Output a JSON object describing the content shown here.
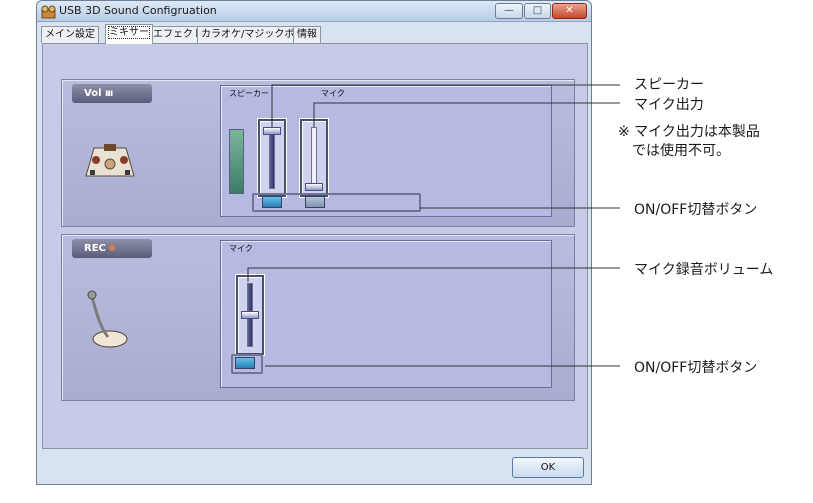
{
  "window": {
    "title": "USB 3D Sound Configruation",
    "minimize_glyph": "—",
    "maximize_glyph": "□",
    "close_glyph": "✕"
  },
  "tabs": [
    {
      "label": "メイン設定",
      "active": false
    },
    {
      "label": "ミキサー",
      "active": true
    },
    {
      "label": "エフェクト",
      "active": false
    },
    {
      "label": "カラオケ/マジックボイス",
      "active": false
    },
    {
      "label": "情報",
      "active": false
    }
  ],
  "playback": {
    "section_label": "Vol",
    "channels": [
      {
        "label": "スピーカー",
        "toggle_on": true
      },
      {
        "label": "マイク",
        "toggle_on": false
      }
    ]
  },
  "recording": {
    "section_label": "REC",
    "channels": [
      {
        "label": "マイク",
        "toggle_on": true
      }
    ]
  },
  "buttons": {
    "ok": "OK"
  },
  "annotations": {
    "speaker": "スピーカー",
    "mic_output": "マイク出力",
    "note": "※ マイク出力は本製品\n　では使用不可。",
    "onoff_playback": "ON/OFF切替ボタン",
    "mic_rec_volume": "マイク録音ボリューム",
    "onoff_recording": "ON/OFF切替ボタン"
  },
  "colors": {
    "panel": "#c7cbe8",
    "toggle_on": "#2a7fb6",
    "close": "#c7472d"
  }
}
